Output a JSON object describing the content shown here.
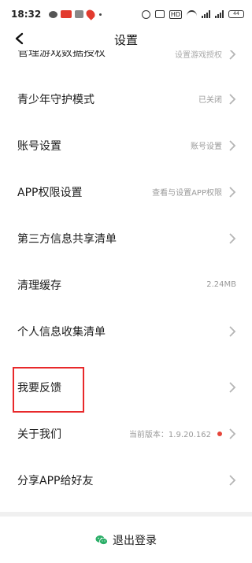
{
  "status_bar": {
    "time": "18:32",
    "battery": "44"
  },
  "nav": {
    "title": "设置"
  },
  "settings": {
    "partial": {
      "label": "管理游戏数据授权",
      "value": "设置游戏授权"
    },
    "items": [
      {
        "label": "青少年守护模式",
        "value": "已关闭",
        "chevron": true
      },
      {
        "label": "账号设置",
        "value": "账号设置",
        "chevron": true
      },
      {
        "label": "APP权限设置",
        "value": "查看与设置APP权限",
        "chevron": true
      },
      {
        "label": "第三方信息共享清单",
        "value": "",
        "chevron": true
      },
      {
        "label": "清理缓存",
        "value": "2.24MB",
        "chevron": false
      },
      {
        "label": "个人信息收集清单",
        "value": "",
        "chevron": true
      },
      {
        "label": "我要反馈",
        "value": "",
        "chevron": true
      },
      {
        "label": "关于我们",
        "value": "当前版本：1.9.20.162",
        "chevron": true,
        "badge": true
      },
      {
        "label": "分享APP给好友",
        "value": "",
        "chevron": true
      }
    ]
  },
  "logout": {
    "label": "退出登录",
    "icon": "wechat-icon"
  },
  "colors": {
    "accent_box": "#e8292b",
    "badge": "#e6453a",
    "wechat": "#2aae67"
  }
}
